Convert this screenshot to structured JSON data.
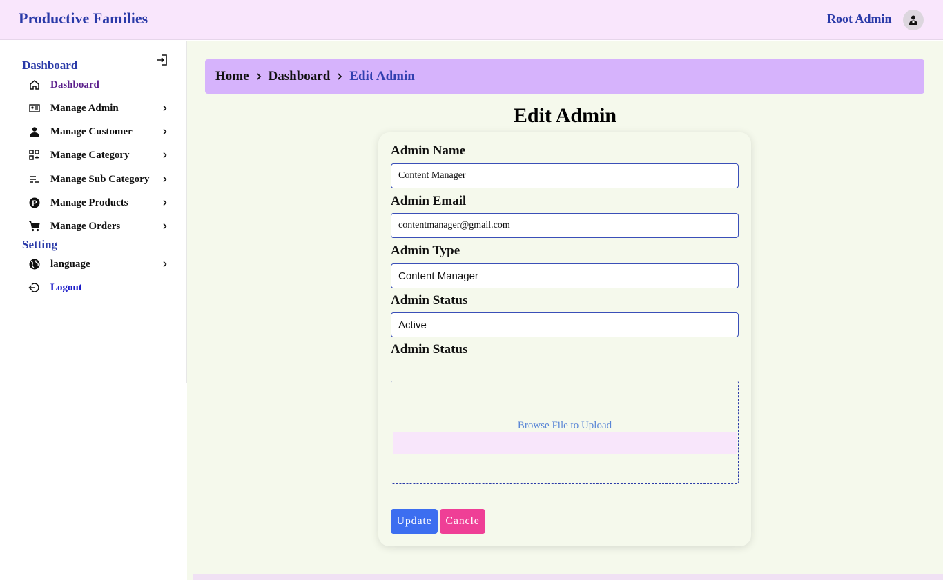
{
  "header": {
    "brand": "Productive Families",
    "user_name": "Root Admin"
  },
  "sidebar": {
    "section_dashboard": "Dashboard",
    "section_setting": "Setting",
    "items": [
      {
        "label": "Dashboard",
        "icon": "home-icon",
        "color": "#5b1f8c",
        "has_chevron": false
      },
      {
        "label": "Manage Admin",
        "icon": "id-card-icon",
        "has_chevron": true
      },
      {
        "label": "Manage Customer",
        "icon": "person-icon",
        "has_chevron": true
      },
      {
        "label": "Manage Category",
        "icon": "grid-add-icon",
        "has_chevron": true
      },
      {
        "label": "Manage Sub Category",
        "icon": "list-minus-icon",
        "has_chevron": true
      },
      {
        "label": "Manage Products",
        "icon": "p-circle-icon",
        "has_chevron": true
      },
      {
        "label": "Manage Orders",
        "icon": "cart-icon",
        "has_chevron": true
      }
    ],
    "setting_items": [
      {
        "label": "language",
        "icon": "globe-icon",
        "has_chevron": true
      },
      {
        "label": "Logout",
        "icon": "logout-icon",
        "color": "#1a1ac8",
        "has_chevron": false
      }
    ]
  },
  "breadcrumb": [
    "Home",
    "Dashboard",
    "Edit Admin"
  ],
  "page_title": "Edit Admin",
  "form": {
    "admin_name_label": "Admin Name",
    "admin_name_value": "Content Manager",
    "admin_email_label": "Admin Email",
    "admin_email_value": "contentmanager@gmail.com",
    "admin_type_label": "Admin Type",
    "admin_type_value": "Content Manager",
    "admin_status_label": "Admin Status",
    "admin_status_value": "Active",
    "admin_image_label": "Admin Status",
    "upload_text": "Browse File to Upload",
    "update_label": "Update",
    "cancel_label": "Cancle"
  },
  "colors": {
    "brand": "#2a3aa8",
    "topbar_bg": "#f9e6fc",
    "breadcrumb_bg": "#d6b3fc",
    "main_bg": "#f5f9ec",
    "update_button": "#3c6ef0",
    "cancel_button": "#ef3f96"
  }
}
